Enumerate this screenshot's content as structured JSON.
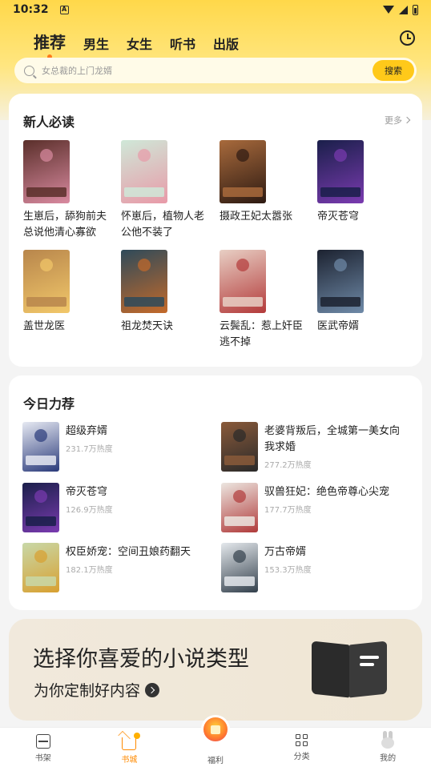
{
  "status_bar": {
    "time": "10:32",
    "notif_glyph": "A"
  },
  "nav_tabs": [
    {
      "label": "推荐",
      "active": true
    },
    {
      "label": "男生",
      "active": false
    },
    {
      "label": "女生",
      "active": false
    },
    {
      "label": "听书",
      "active": false
    },
    {
      "label": "出版",
      "active": false
    }
  ],
  "search": {
    "placeholder": "女总裁的上门龙婿",
    "button_label": "搜索"
  },
  "newbie": {
    "title": "新人必读",
    "more_label": "更多",
    "books": [
      {
        "title": "生崽后，舔狗前夫总说他清心寡欲",
        "colors": [
          "#5a2f2a",
          "#d98aa0"
        ]
      },
      {
        "title": "怀崽后，植物人老公他不装了",
        "colors": [
          "#cfe8d8",
          "#e89aa8"
        ]
      },
      {
        "title": "摄政王妃太嚣张",
        "colors": [
          "#a86a3c",
          "#2d1a12"
        ]
      },
      {
        "title": "帝灭苍穹",
        "colors": [
          "#1a1f4a",
          "#7a3bb0"
        ]
      },
      {
        "title": "盖世龙医",
        "colors": [
          "#b8864c",
          "#f2c86a"
        ]
      },
      {
        "title": "祖龙焚天诀",
        "colors": [
          "#2e4a5a",
          "#c46a2a"
        ]
      },
      {
        "title": "云鬓乱：惹上奸臣逃不掉",
        "colors": [
          "#e8cfc4",
          "#b33a3a"
        ]
      },
      {
        "title": "医武帝婿",
        "colors": [
          "#1c2230",
          "#6f8aa8"
        ]
      }
    ]
  },
  "today": {
    "title": "今日力荐",
    "books": [
      {
        "title": "超级弃婿",
        "heat": "231.7万热度",
        "colors": [
          "#e6e9f2",
          "#2a3a7a"
        ]
      },
      {
        "title": "老婆背叛后，全城第一美女向我求婚",
        "heat": "277.2万热度",
        "colors": [
          "#8a5a3a",
          "#2a2a2a"
        ]
      },
      {
        "title": "帝灭苍穹",
        "heat": "126.9万热度",
        "colors": [
          "#1a1f4a",
          "#7a3bb0"
        ]
      },
      {
        "title": "驭兽狂妃：绝色帝尊心尖宠",
        "heat": "177.7万热度",
        "colors": [
          "#ece6e0",
          "#b03a3a"
        ]
      },
      {
        "title": "权臣娇宠：空间丑娘药翻天",
        "heat": "182.1万热度",
        "colors": [
          "#c8d8a8",
          "#d8a030"
        ]
      },
      {
        "title": "万古帝婿",
        "heat": "153.3万热度",
        "colors": [
          "#e4e8ec",
          "#33404c"
        ]
      }
    ]
  },
  "banner": {
    "title": "选择你喜爱的小说类型",
    "subtitle": "为你定制好内容"
  },
  "bottom_nav": [
    {
      "label": "书架",
      "icon": "bookshelf-icon"
    },
    {
      "label": "书城",
      "icon": "home-icon",
      "active": true
    },
    {
      "label": "福利",
      "icon": "gift-icon"
    },
    {
      "label": "分类",
      "icon": "grid-icon"
    },
    {
      "label": "我的",
      "icon": "bunny-avatar-icon"
    }
  ],
  "colors": {
    "accent": "#ffc91a",
    "active_nav": "#ff8a00",
    "tab_dot": "#ff7a1a"
  }
}
